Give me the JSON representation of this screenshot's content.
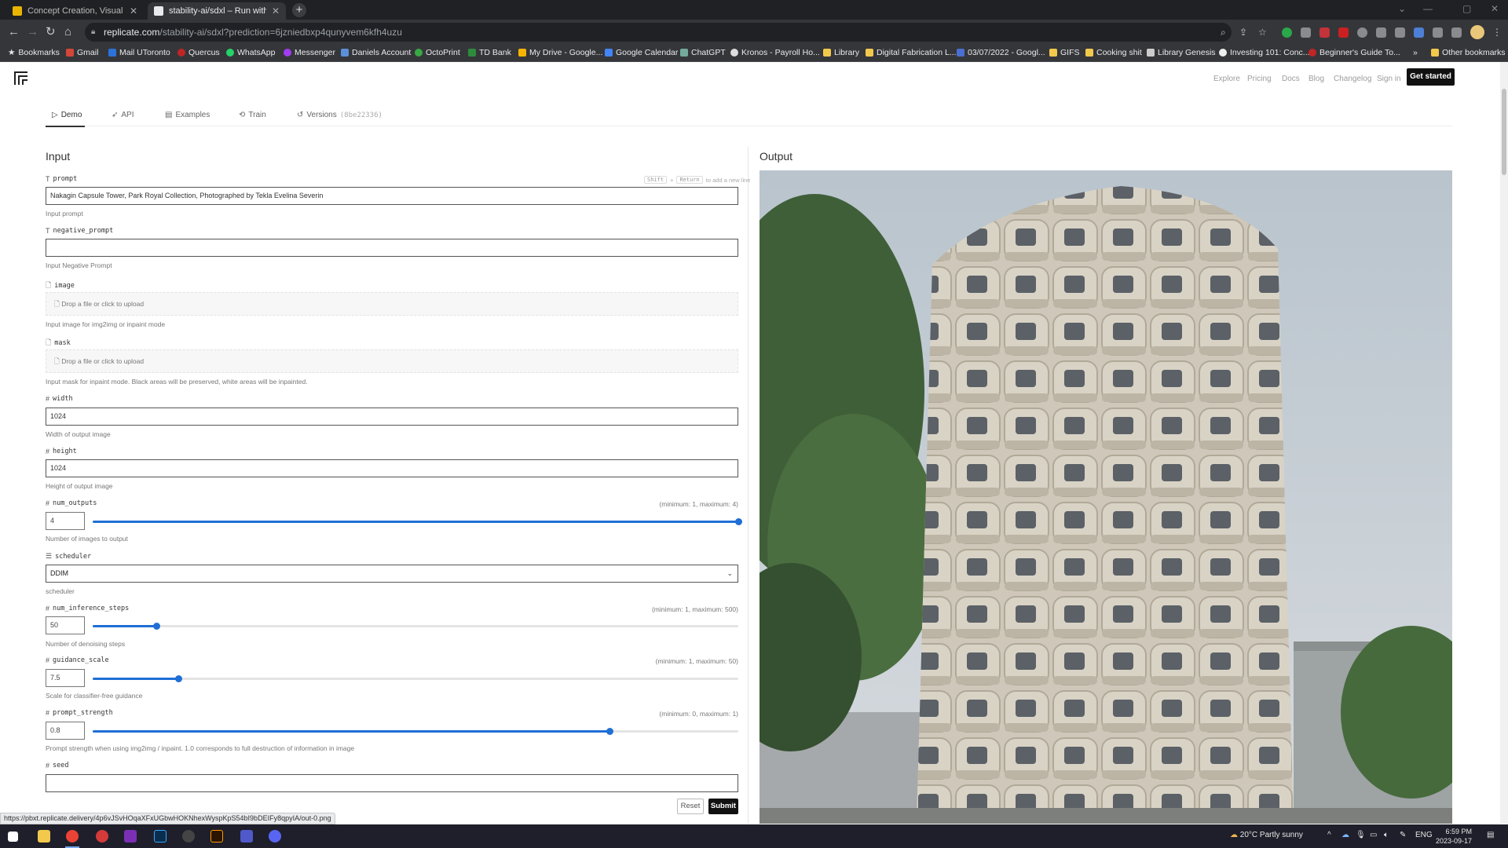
{
  "browser": {
    "tabs": [
      {
        "title": "Concept Creation, Visual Worksp",
        "active": false
      },
      {
        "title": "stability-ai/sdxl – Run with an AP",
        "active": true
      }
    ],
    "url_host": "replicate.com",
    "url_path": "/stability-ai/sdxl?prediction=6jzniedbxp4qunyvem6kfh4uzu",
    "bookmarks": [
      "Bookmarks",
      "Gmail",
      "Mail UToronto",
      "Quercus",
      "WhatsApp",
      "Messenger",
      "Daniels Account",
      "OctoPrint",
      "TD Bank",
      "My Drive - Google...",
      "Google Calendar",
      "ChatGPT",
      "Kronos - Payroll Ho...",
      "Library",
      "Digital Fabrication L...",
      "03/07/2022 - Googl...",
      "GIFS",
      "Cooking shit",
      "Library Genesis",
      "Investing 101: Conc...",
      "Beginner's Guide To...",
      "Other bookmarks"
    ],
    "bookmarks_more": "»",
    "status_url": "https://pbxt.replicate.delivery/4p6vJSvHOqaXFxUGbwHOKNhexWyspKpS54bI9bDEIFy8qpyIA/out-0.png"
  },
  "site": {
    "nav": [
      "Explore",
      "Pricing",
      "Docs",
      "Blog",
      "Changelog",
      "Sign in"
    ],
    "cta": "Get started"
  },
  "subtabs": {
    "demo": "Demo",
    "api": "API",
    "examples": "Examples",
    "train": "Train",
    "versions": "Versions",
    "version_hash": "(8be22336)"
  },
  "input": {
    "title": "Input",
    "newline_hint": {
      "shift": "Shift",
      "plus": "+",
      "ret": "Return",
      "text": "to add a new line"
    },
    "prompt": {
      "label": "prompt",
      "value": "Nakagin Capsule Tower, Park Royal Collection, Photographed by Tekla Evelina Severin",
      "help": "Input prompt"
    },
    "negative_prompt": {
      "label": "negative_prompt",
      "value": "",
      "help": "Input Negative Prompt"
    },
    "image": {
      "label": "image",
      "drop": "Drop a file or click to upload",
      "help": "Input image for img2img or inpaint mode"
    },
    "mask": {
      "label": "mask",
      "drop": "Drop a file or click to upload",
      "help": "Input mask for inpaint mode. Black areas will be preserved, white areas will be inpainted."
    },
    "width": {
      "label": "width",
      "value": "1024",
      "help": "Width of output image"
    },
    "height": {
      "label": "height",
      "value": "1024",
      "help": "Height of output image"
    },
    "num_outputs": {
      "label": "num_outputs",
      "value": "4",
      "range": "(minimum: 1, maximum: 4)",
      "help": "Number of images to output",
      "min": 1,
      "max": 4
    },
    "scheduler": {
      "label": "scheduler",
      "value": "DDIM",
      "help": "scheduler"
    },
    "num_inference_steps": {
      "label": "num_inference_steps",
      "value": "50",
      "range": "(minimum: 1, maximum: 500)",
      "help": "Number of denoising steps",
      "min": 1,
      "max": 500
    },
    "guidance_scale": {
      "label": "guidance_scale",
      "value": "7.5",
      "range": "(minimum: 1, maximum: 50)",
      "help": "Scale for classifier-free guidance",
      "min": 1,
      "max": 50
    },
    "prompt_strength": {
      "label": "prompt_strength",
      "value": "0.8",
      "range": "(minimum: 0, maximum: 1)",
      "help": "Prompt strength when using img2img / inpaint. 1.0 corresponds to full destruction of information in image",
      "min": 0,
      "max": 1
    },
    "seed": {
      "label": "seed",
      "value": ""
    },
    "reset": "Reset",
    "submit": "Submit"
  },
  "output": {
    "title": "Output"
  },
  "taskbar": {
    "weather": "20°C  Partly sunny",
    "lang": "ENG",
    "time": "6:59 PM",
    "date": "2023-09-17"
  },
  "colors": {
    "accent": "#1f6fd6",
    "browser_dark": "#202124",
    "toolbar": "#35363a"
  }
}
